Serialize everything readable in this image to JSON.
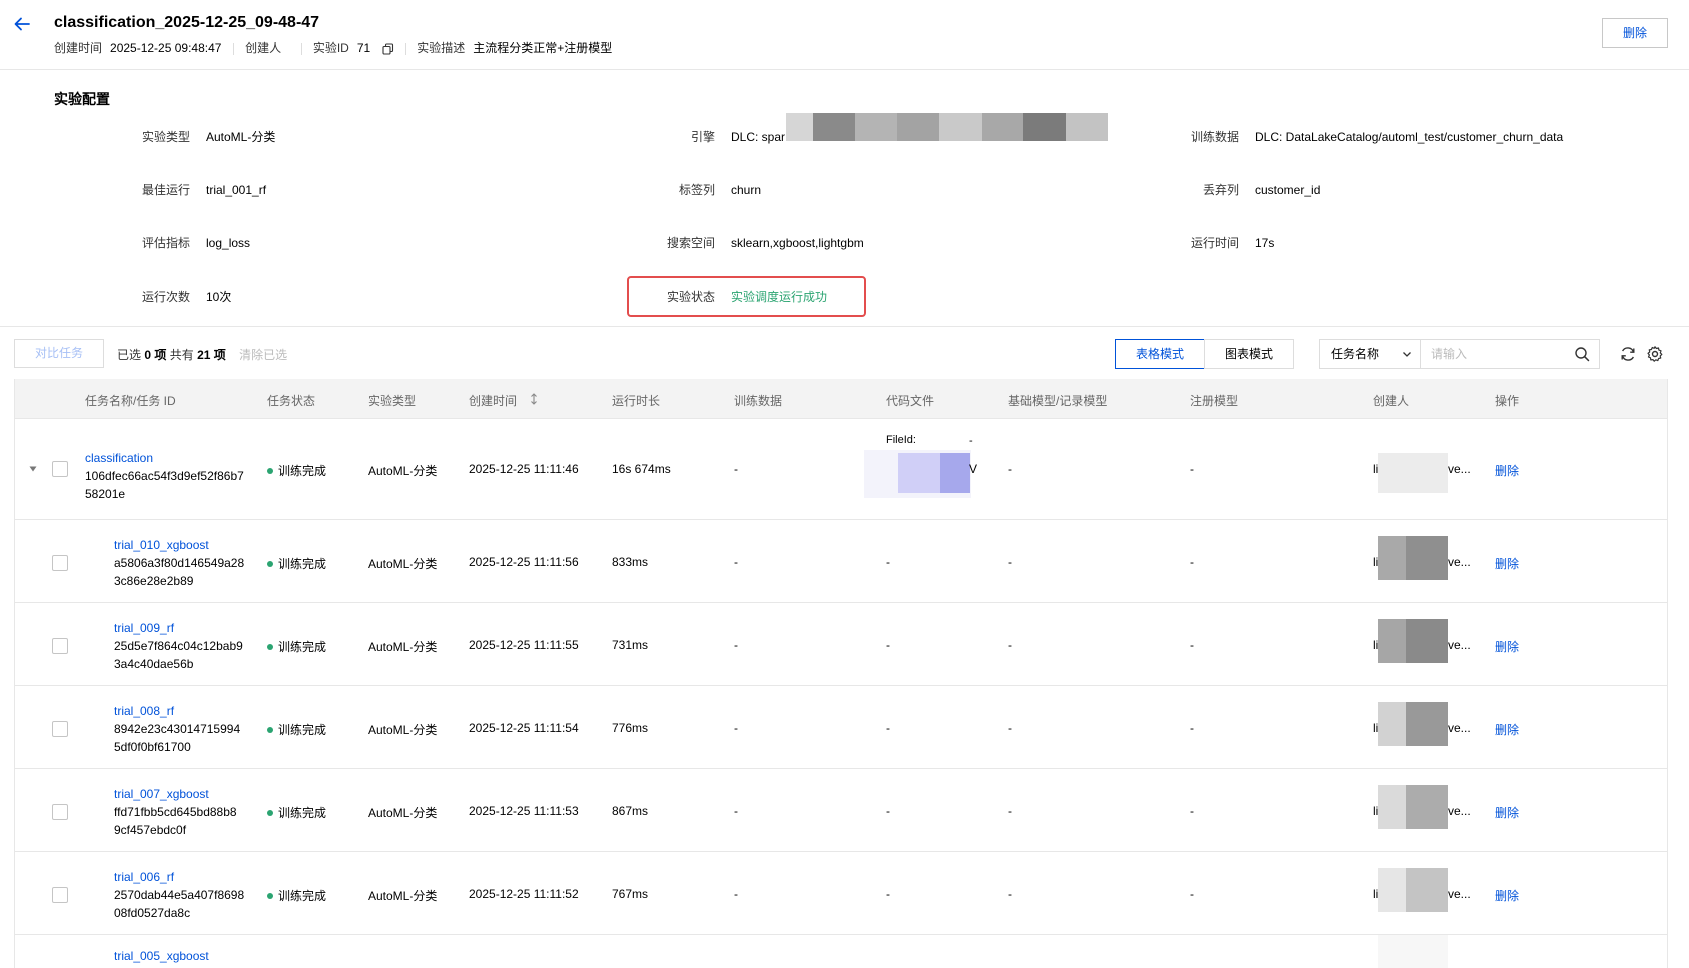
{
  "header": {
    "title": "classification_2025-12-25_09-48-47",
    "created_time_label": "创建时间",
    "created_time": "2025-12-25 09:48:47",
    "creator_label": "创建人",
    "creator": "",
    "exp_id_label": "实验ID",
    "exp_id": "71",
    "desc_label": "实验描述",
    "desc": "主流程分类正常+注册模型",
    "delete_label": "删除"
  },
  "config": {
    "section_title": "实验配置",
    "exp_type_label": "实验类型",
    "exp_type": "AutoML-分类",
    "engine_label": "引擎",
    "engine": "DLC: spar",
    "train_data_label": "训练数据",
    "train_data": "DLC: DataLakeCatalog/automl_test/customer_churn_data",
    "best_run_label": "最佳运行",
    "best_run": "trial_001_rf",
    "label_col_label": "标签列",
    "label_col": "churn",
    "drop_col_label": "丢弃列",
    "drop_col": "customer_id",
    "metric_label": "评估指标",
    "metric": "log_loss",
    "search_space_label": "搜索空间",
    "search_space": "sklearn,xgboost,lightgbm",
    "run_time_label": "运行时间",
    "run_time": "17s",
    "run_count_label": "运行次数",
    "run_count": "10次",
    "status_label": "实验状态",
    "status": "实验调度运行成功"
  },
  "toolbar": {
    "compare_label": "对比任务",
    "selected_prefix": "已选",
    "selected_count": "0 项",
    "total_prefix": "共有",
    "total_count": "21 项",
    "clear_label": "清除已选",
    "table_mode": "表格模式",
    "chart_mode": "图表模式",
    "search_field": "任务名称",
    "search_placeholder": "请输入"
  },
  "table": {
    "columns": [
      "任务名称/任务 ID",
      "任务状态",
      "实验类型",
      "创建时间",
      "运行时长",
      "训练数据",
      "代码文件",
      "基础模型/记录模型",
      "注册模型",
      "创建人",
      "操作"
    ],
    "rows": [
      {
        "name": "classification",
        "id1": "106dfec66ac54f3d9ef52f86b7",
        "id2": "58201e",
        "status": "训练完成",
        "type": "AutoML-分类",
        "created": "2025-12-25 11:11:46",
        "duration": "16s 674ms",
        "train_data": "-",
        "code_file": "FileId:",
        "code_tail": "V",
        "base_model": "-",
        "reg_model": "-",
        "creator_head": "li",
        "creator_tail": "ve...",
        "op": "删除"
      },
      {
        "name": "trial_010_xgboost",
        "id1": "a5806a3f80d146549a28",
        "id2": "3c86e28e2b89",
        "status": "训练完成",
        "type": "AutoML-分类",
        "created": "2025-12-25 11:11:56",
        "duration": "833ms",
        "train_data": "-",
        "code_file": "-",
        "base_model": "-",
        "reg_model": "-",
        "creator_head": "li",
        "creator_tail": "ve...",
        "op": "删除"
      },
      {
        "name": "trial_009_rf",
        "id1": "25d5e7f864c04c12bab9",
        "id2": "3a4c40dae56b",
        "status": "训练完成",
        "type": "AutoML-分类",
        "created": "2025-12-25 11:11:55",
        "duration": "731ms",
        "train_data": "-",
        "code_file": "-",
        "base_model": "-",
        "reg_model": "-",
        "creator_head": "li",
        "creator_tail": "ve...",
        "op": "删除"
      },
      {
        "name": "trial_008_rf",
        "id1": "8942e23c43014715994",
        "id2": "5df0f0bf61700",
        "status": "训练完成",
        "type": "AutoML-分类",
        "created": "2025-12-25 11:11:54",
        "duration": "776ms",
        "train_data": "-",
        "code_file": "-",
        "base_model": "-",
        "reg_model": "-",
        "creator_head": "li",
        "creator_tail": "ve...",
        "op": "删除"
      },
      {
        "name": "trial_007_xgboost",
        "id1": "ffd71fbb5cd645bd88b8",
        "id2": "9cf457ebdc0f",
        "status": "训练完成",
        "type": "AutoML-分类",
        "created": "2025-12-25 11:11:53",
        "duration": "867ms",
        "train_data": "-",
        "code_file": "-",
        "base_model": "-",
        "reg_model": "-",
        "creator_head": "li",
        "creator_tail": "ve...",
        "op": "删除"
      },
      {
        "name": "trial_006_rf",
        "id1": "2570dab44e5a407f8698",
        "id2": "08fd0527da8c",
        "status": "训练完成",
        "type": "AutoML-分类",
        "created": "2025-12-25 11:11:52",
        "duration": "767ms",
        "train_data": "-",
        "code_file": "-",
        "base_model": "-",
        "reg_model": "-",
        "creator_head": "li",
        "creator_tail": "ve...",
        "op": "删除"
      },
      {
        "name": "trial_005_xgboost"
      }
    ]
  },
  "colors": {
    "primary": "#0052d9",
    "success": "#2ba471",
    "highlight_border": "#e34d4d"
  }
}
